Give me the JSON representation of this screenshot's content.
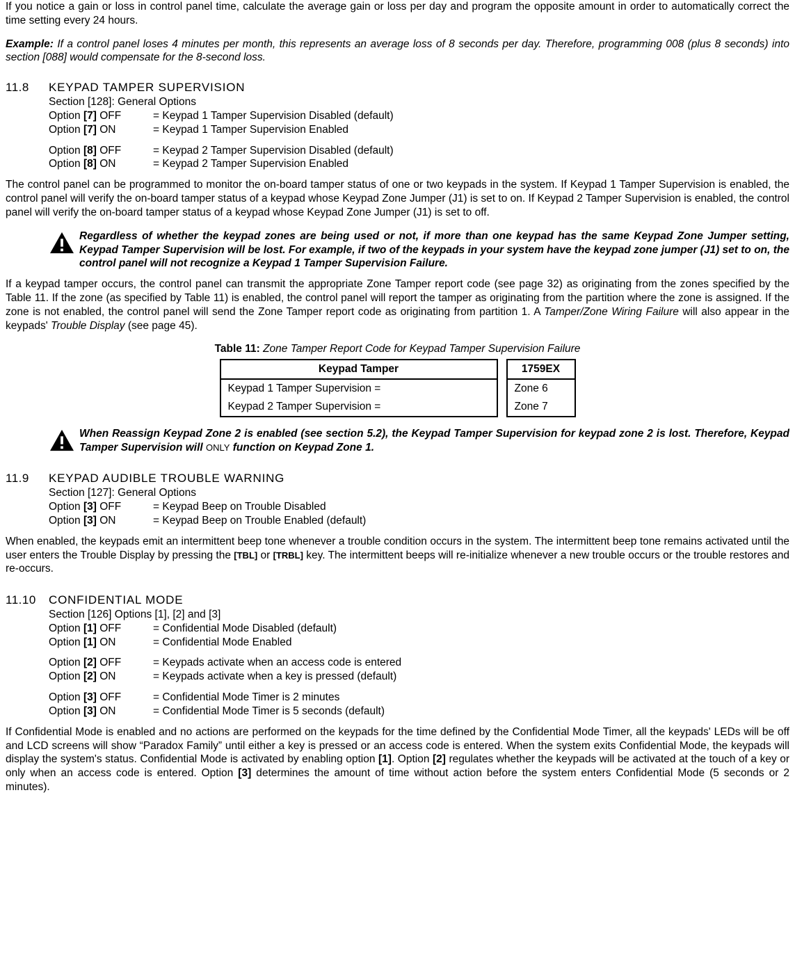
{
  "intro": {
    "p0": "If you notice a gain or loss in control panel time, calculate the average gain or loss per day and program the opposite amount in order to automatically correct the time setting every 24 hours.",
    "example_label": "Example:",
    "p1": " If a control panel loses 4 minutes per month, this represents an average loss of 8 seconds per day. Therefore, programming 008 (plus 8 seconds) into section [088] would compensate for the 8-second loss."
  },
  "s118": {
    "num": "11.8",
    "title": "KEYPAD TAMPER SUPERVISION",
    "section_line": "Section [128]: General Options",
    "opt7off_lead": "Option [7] OFF",
    "opt7off_rest": "= Keypad 1 Tamper Supervision Disabled (default)",
    "opt7on_lead": "Option [7] ON",
    "opt7on_rest": "= Keypad 1 Tamper Supervision Enabled",
    "opt8off_lead": "Option [8] OFF",
    "opt8off_rest": "= Keypad 2 Tamper Supervision Disabled (default)",
    "opt8on_lead": "Option [8] ON",
    "opt8on_rest": "= Keypad 2 Tamper Supervision Enabled",
    "para1": "The control panel can be programmed to monitor the on-board tamper status of one or two keypads in the system. If Keypad 1 Tamper Supervision is enabled, the control panel will verify the on-board tamper status of a keypad whose Keypad Zone Jumper (J1) is set to on. If Keypad 2 Tamper Supervision is enabled, the control panel will verify the on-board tamper status of a keypad whose Keypad Zone Jumper (J1) is set to off.",
    "warn1": "Regardless of whether the keypad zones are being used or not, if more than one keypad has the same Keypad Zone Jumper setting, Keypad Tamper Supervision will be lost. For example, if two of the keypads in your system have the keypad zone jumper (J1) set to on, the control panel will not recognize a Keypad 1 Tamper Supervision Failure.",
    "para2_a": "If a keypad tamper occurs, the control panel can transmit the appropriate Zone Tamper report code (see page 32) as originating from the zones specified by the Table 11. If the zone (as specified by Table 11) is enabled, the control panel will report the tamper as originating from the partition where the zone is assigned. If the zone is not enabled, the control panel will send the Zone Tamper report code as originating from partition 1. A ",
    "para2_i1": "Tamper/Zone Wiring Failure",
    "para2_b": " will also appear in the keypads' ",
    "para2_i2": "Trouble Display",
    "para2_c": " (see page 45).",
    "table_caption_bold": "Table 11: ",
    "table_caption_ital": "Zone Tamper Report Code for Keypad Tamper Supervision Failure",
    "t1_head": "Keypad Tamper",
    "t1_r1": "Keypad 1 Tamper Supervision =",
    "t1_r2": "Keypad 2 Tamper Supervision =",
    "t2_head": "1759EX",
    "t2_r1": "Zone 6",
    "t2_r2": "Zone 7",
    "warn2_a": "When Reassign Keypad Zone 2 is enabled (see section 5.2), the Keypad Tamper Supervision for keypad zone 2 is lost. Therefore, Keypad Tamper Supervision will ",
    "warn2_only": "ONLY",
    "warn2_b": " function on Keypad Zone 1."
  },
  "s119": {
    "num": "11.9",
    "title": "KEYPAD AUDIBLE TROUBLE WARNING",
    "section_line": "Section [127]: General Options",
    "opt3off_lead": "Option [3] OFF",
    "opt3off_rest": "= Keypad Beep on Trouble Disabled",
    "opt3on_lead": "Option [3] ON",
    "opt3on_rest": "= Keypad Beep on Trouble Enabled (default)",
    "para_a": "When enabled, the keypads emit an intermittent beep tone whenever a trouble condition occurs in the system. The intermittent beep tone remains activated until the user enters the Trouble Display by pressing the ",
    "para_k1": "[TBL]",
    "para_b": " or ",
    "para_k2": "[TRBL]",
    "para_c": " key. The intermittent beeps will re-initialize whenever a new trouble occurs or the trouble restores and re-occurs."
  },
  "s1110": {
    "num": "11.10",
    "title": "CONFIDENTIAL MODE",
    "section_line": "Section [126] Options [1], [2] and [3]",
    "opt1off_lead": "Option [1] OFF",
    "opt1off_rest": "= Confidential Mode Disabled (default)",
    "opt1on_lead": "Option [1] ON",
    "opt1on_rest": "= Confidential Mode Enabled",
    "opt2off_lead": "Option [2] OFF",
    "opt2off_rest": "= Keypads activate when an access code is entered",
    "opt2on_lead": "Option [2] ON",
    "opt2on_rest": "= Keypads activate when a key is pressed (default)",
    "opt3off_lead": "Option [3] OFF",
    "opt3off_rest": "= Confidential Mode Timer is 2 minutes",
    "opt3on_lead": "Option [3] ON",
    "opt3on_rest": "= Confidential Mode Timer is 5 seconds (default)",
    "para_a": "If Confidential Mode is enabled and no actions are performed on the keypads for the time defined by the Confidential Mode Timer, all the keypads' LEDs will be off and LCD screens will show “Paradox Family” until either a key is pressed or an access code is entered. When the system exits Confidential Mode, the keypads will display the system's status. Confidential Mode is activated by enabling option ",
    "para_k1": "[1]",
    "para_b": ". Option ",
    "para_k2": "[2]",
    "para_c": " regulates whether the keypads will be activated at the touch of a key or only when an access code is entered. Option ",
    "para_k3": "[3]",
    "para_d": " determines the amount of time without action before the system enters Confidential Mode (5 seconds or 2 minutes)."
  }
}
